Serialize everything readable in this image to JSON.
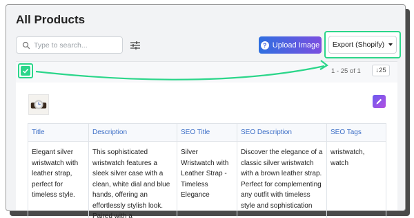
{
  "page": {
    "title": "All Products"
  },
  "search": {
    "placeholder": "Type to search..."
  },
  "toolbar": {
    "upload_label": "Upload Image",
    "export_label": "Export (Shopify)"
  },
  "pagination": {
    "range_text": "1 - 25 of 1",
    "page_size": "25"
  },
  "table": {
    "columns": [
      "Title",
      "Description",
      "SEO Title",
      "SEO Description",
      "SEO Tags"
    ],
    "rows": [
      {
        "title": "Elegant silver wristwatch with leather strap, perfect for timeless style.",
        "description": "This sophisticated wristwatch features a sleek silver case with a clean, white dial and blue hands, offering an effortlessly stylish look. Paired with a",
        "seo_title": "Silver Wristwatch with Leather Strap - Timeless Elegance",
        "seo_description": "Discover the elegance of a classic silver wristwatch with a brown leather strap. Perfect for complementing any outfit with timeless style and sophistication",
        "seo_tags": "wristwatch, watch"
      }
    ]
  },
  "colors": {
    "highlight": "#2bd68a",
    "link": "#3d6fc7",
    "upload_gradient_start": "#2f6fe0",
    "upload_gradient_end": "#7b4fe0"
  },
  "icons": {
    "search": "search-icon",
    "filter": "sliders-icon",
    "upload": "question-circle-icon",
    "edit": "pencil-icon",
    "check": "check-icon",
    "sort": "arrow-down-icon"
  }
}
